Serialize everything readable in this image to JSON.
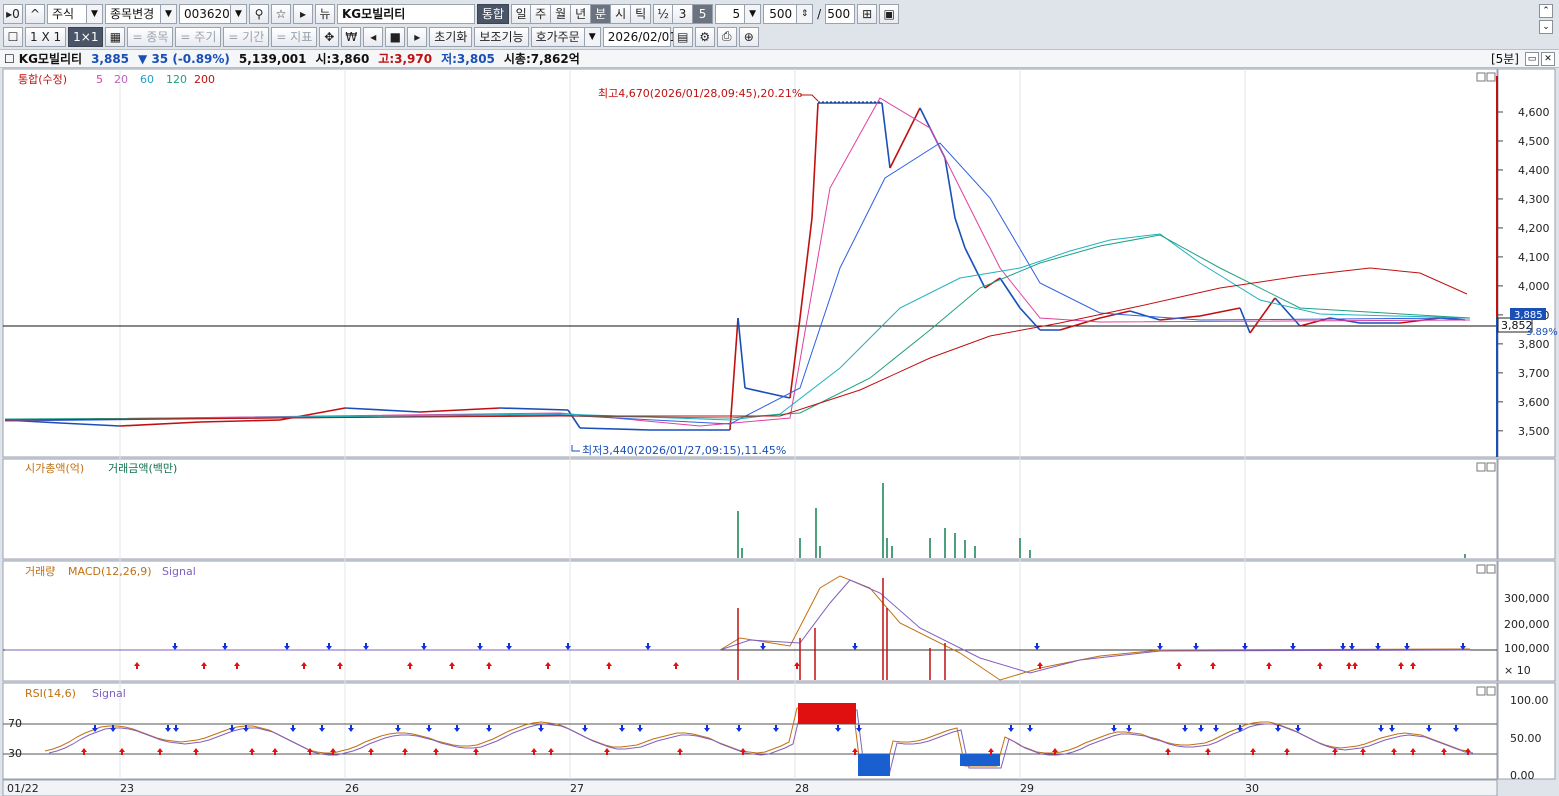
{
  "toolbar1": {
    "menu_btn": "▸0",
    "up_btn": "^",
    "market_select": "주식",
    "change_select": "종목변경",
    "code_input": "003620",
    "search_icon": "search-icon",
    "favorite_icon": "star-icon",
    "new_btn": "뉴",
    "stock_name": "KG모빌리티",
    "combined_btn": "통합",
    "period_tabs": [
      "일",
      "주",
      "월",
      "년",
      "분",
      "시",
      "틱"
    ],
    "period_selected": "분",
    "minute_options": [
      "½",
      "3",
      "5"
    ],
    "minute_selected": "5",
    "interval_value": "5",
    "count_value": "500",
    "slash": "/",
    "total_count": "500"
  },
  "toolbar2": {
    "layout_1x1": "1 X 1",
    "layout_grid": "1×1",
    "add_stock": "= 종목",
    "add_period": "= 주기",
    "add_range": "= 기간",
    "add_indicator": "= 지표",
    "reset_btn": "초기화",
    "aux_btn": "보조기능",
    "order_btn": "호가주문",
    "date_value": "2026/02/01"
  },
  "info": {
    "name": "KG모빌리티",
    "price": "3,885",
    "change": "▼ 35 (-0.89%)",
    "volume": "5,139,001",
    "open": "시:3,860",
    "high": "고:3,970",
    "low": "저:3,805",
    "mktcap": "시총:7,862억",
    "timeframe": "[5분]"
  },
  "panes": {
    "price": {
      "legend": [
        "통합(수정)",
        "5",
        "20",
        "60",
        "120",
        "200"
      ]
    },
    "marketcap": {
      "legend": [
        "시가총액(억)",
        "거래금액(백만)"
      ]
    },
    "macd": {
      "legend": [
        "거래량",
        "MACD(12,26,9)",
        "Signal"
      ]
    },
    "rsi": {
      "legend": [
        "RSI(14,6)",
        "Signal"
      ]
    }
  },
  "annotations": {
    "high": "최고4,670(2026/01/28,09:45),20.21%",
    "low": "최저3,440(2026/01/27,09:15),11.45%"
  },
  "current_price_label": "3,852",
  "price_axis_tag": "3,885",
  "price_axis_pct": "3.89%",
  "chart_data": {
    "type": "line",
    "price_axis": {
      "ticks": [
        "4,600",
        "4,500",
        "4,400",
        "4,300",
        "4,200",
        "4,100",
        "4,000",
        "3,900",
        "3,800",
        "3,700",
        "3,600",
        "3,500"
      ],
      "range": [
        3420,
        4700
      ]
    },
    "macd_axis": {
      "ticks": [
        "300,000",
        "200,000",
        "100,000",
        "× 10"
      ]
    },
    "rsi_axis": {
      "ticks": [
        "100.00",
        "50.00",
        "0.00"
      ],
      "levels": [
        "70",
        "30"
      ]
    },
    "x_labels": [
      "01/22",
      "23",
      "26",
      "27",
      "28",
      "29",
      "30"
    ],
    "ma_colors": {
      "5": "#e040a0",
      "20": "#3060e0",
      "60": "#20b0c0",
      "120": "#20a080",
      "200": "#c01010"
    }
  }
}
